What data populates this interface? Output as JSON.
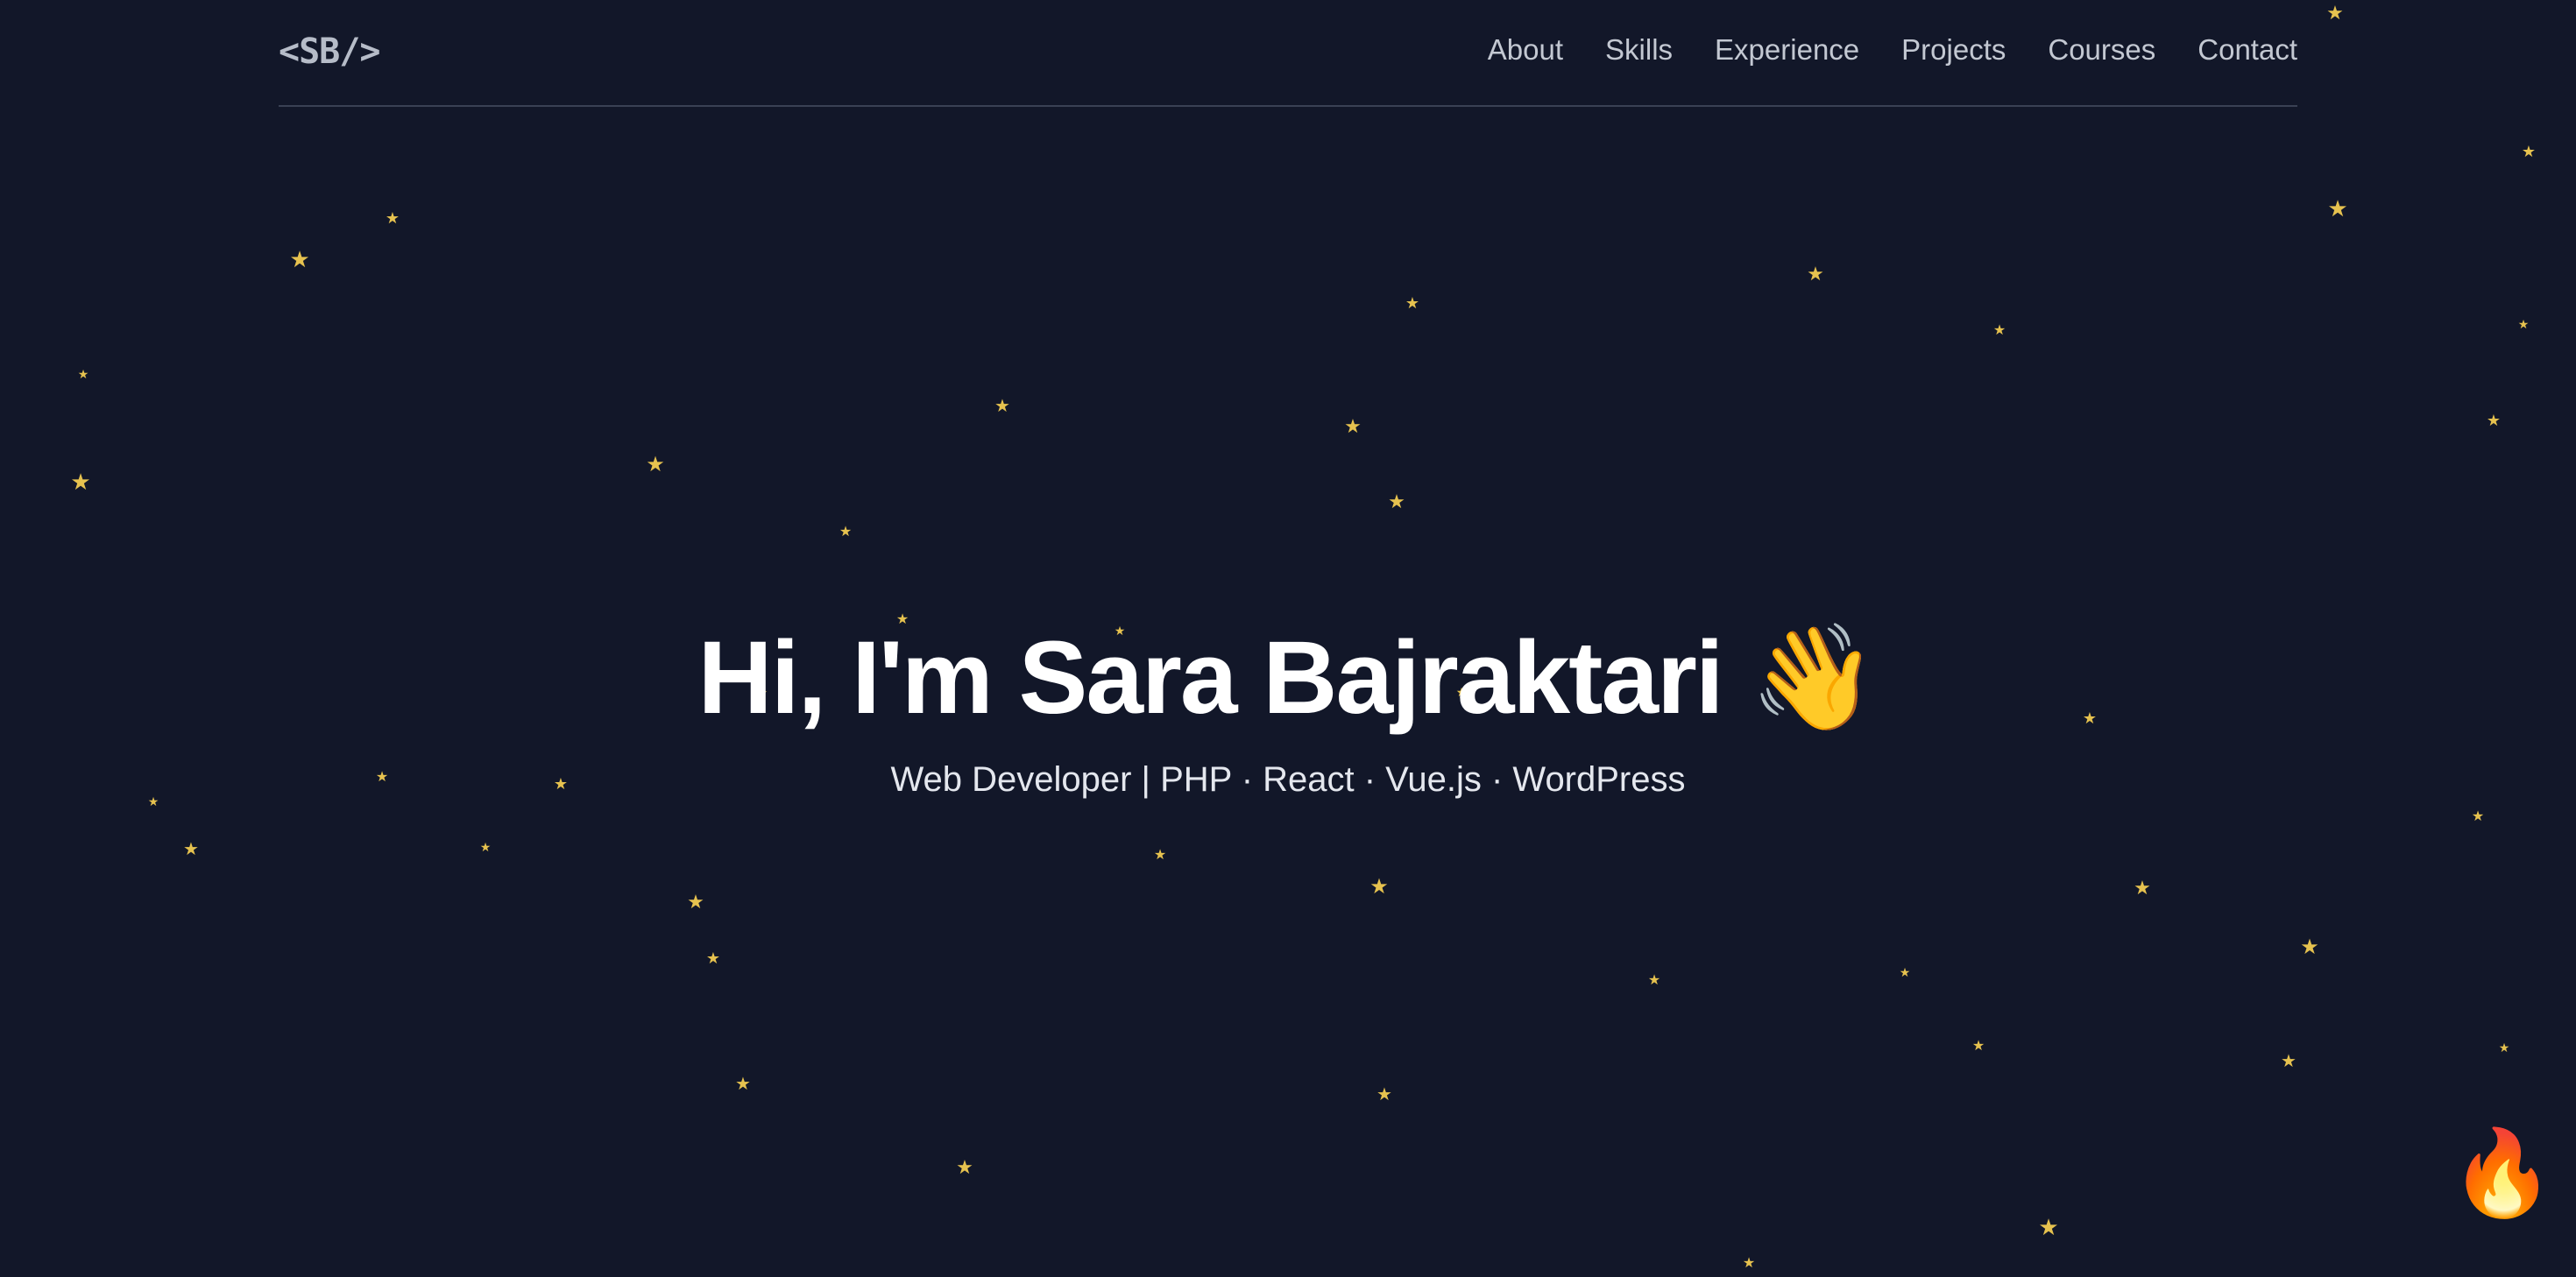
{
  "header": {
    "logo": "<SB/>",
    "nav": [
      "About",
      "Skills",
      "Experience",
      "Projects",
      "Courses",
      "Contact"
    ]
  },
  "hero": {
    "title": "Hi, I'm Sara Bajraktari",
    "wave_emoji": "👋",
    "subtitle": "Web Developer | PHP · React · Vue.js · WordPress"
  },
  "floating_button": {
    "icon": "fire-icon",
    "glyph": "🔥"
  },
  "colors": {
    "background": "#121729",
    "star": "#e6c24f",
    "text": "#ffffff",
    "nav_text": "#c3c8d2"
  }
}
